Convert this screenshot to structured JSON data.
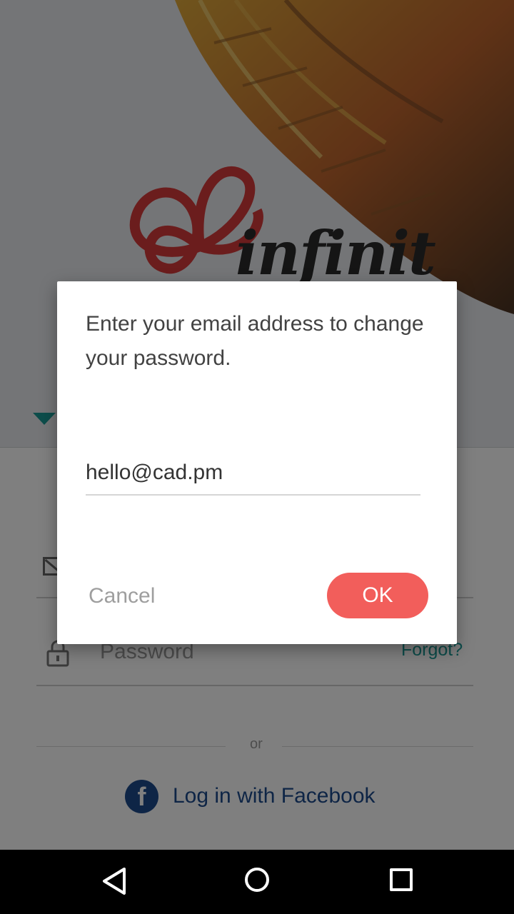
{
  "app": {
    "logo_text": "infinit"
  },
  "login_form": {
    "password_placeholder": "Password",
    "forgot_link": "Forgot?",
    "separator_text": "or",
    "facebook_label": "Log in with Facebook",
    "facebook_icon_glyph": "f"
  },
  "dialog": {
    "message": "Enter your email address to change your password.",
    "email_value": "hello@cad.pm",
    "cancel_label": "Cancel",
    "ok_label": "OK"
  },
  "colors": {
    "accent": "#1a9a96",
    "ok_button": "#f25e5b",
    "facebook": "#1d4a8c",
    "logo_red": "#d63b3b"
  },
  "icons": {
    "back": "back-triangle-icon",
    "home": "home-circle-icon",
    "recents": "recents-square-icon",
    "mail": "mail-icon",
    "lock": "lock-icon",
    "facebook": "facebook-icon",
    "dropdown": "caret-down-icon"
  }
}
